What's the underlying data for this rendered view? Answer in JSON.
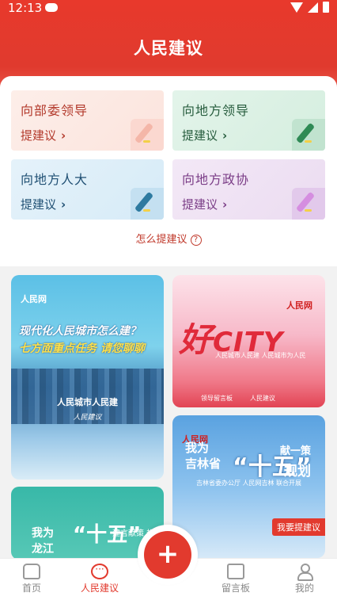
{
  "status": {
    "time": "12:13"
  },
  "header": {
    "title": "人民建议"
  },
  "cards": [
    {
      "title": "向部委领导",
      "action": "提建议"
    },
    {
      "title": "向地方领导",
      "action": "提建议"
    },
    {
      "title": "向地方人大",
      "action": "提建议"
    },
    {
      "title": "向地方政协",
      "action": "提建议"
    }
  ],
  "help": {
    "label": "怎么提建议",
    "icon": "?"
  },
  "banners": {
    "b1": {
      "logo": "人民网",
      "line1": "现代化人民城市怎么建？",
      "line2": "七方面重点任务 请您聊聊",
      "sub": "人民城市人民建",
      "sign": "人民建议"
    },
    "b2": {
      "logo": "人民网",
      "big": "好",
      "big2": "CITY",
      "slogan": "人民城市人民建  人民城市为人民",
      "foot_left": "领导留言板",
      "foot_right": "人民建议"
    },
    "b3": {
      "logo": "人民网",
      "line1": "我为",
      "line2": "吉林省",
      "big": "“十五”",
      "tail1": "献一策",
      "tail2": "规划",
      "sub": "吉林省委办公厅 人民网吉林 联合开展",
      "tag": "我要提建议"
    },
    "b4": {
      "line1": "我为",
      "line2": "龙江",
      "big": "“十五”",
      "tail": "建言献策 规划"
    }
  },
  "fab": {
    "symbol": "+"
  },
  "nav": [
    {
      "label": "首页"
    },
    {
      "label": "人民建议"
    },
    {
      "label": "留言板"
    },
    {
      "label": "我的"
    }
  ],
  "colors": {
    "brand": "#e23a2e"
  }
}
